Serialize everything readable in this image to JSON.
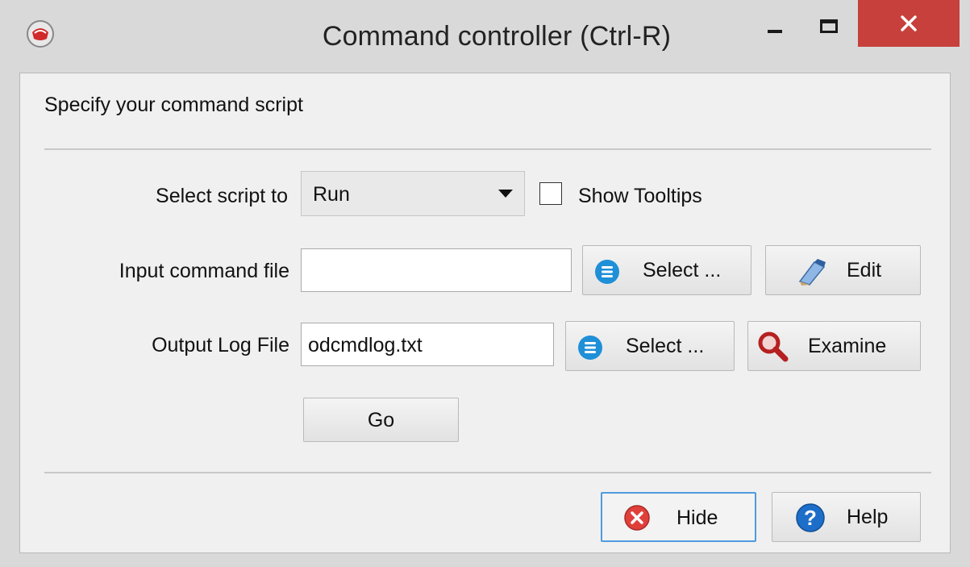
{
  "window": {
    "title": "Command controller (Ctrl-R)",
    "controls": {
      "minimize": "minimize-icon",
      "maximize": "maximize-icon",
      "close": "close-icon"
    }
  },
  "form": {
    "heading": "Specify your command script",
    "select_script_label": "Select script to",
    "select_script_value": "Run",
    "show_tooltips_label": "Show Tooltips",
    "show_tooltips_checked": false,
    "input_file_label": "Input command file",
    "input_file_value": "",
    "input_select_label": "Select ...",
    "edit_label": "Edit",
    "output_log_label": "Output Log File",
    "output_log_value": "odcmdlog.txt",
    "output_select_label": "Select ...",
    "examine_label": "Examine",
    "go_label": "Go"
  },
  "footer": {
    "hide_label": "Hide",
    "help_label": "Help"
  },
  "colors": {
    "close_button": "#c7403c",
    "select_icon": "#1f8fd8",
    "hide_icon": "#e0403a",
    "help_icon": "#1d6ec8",
    "focus_border": "#4f9be0"
  }
}
